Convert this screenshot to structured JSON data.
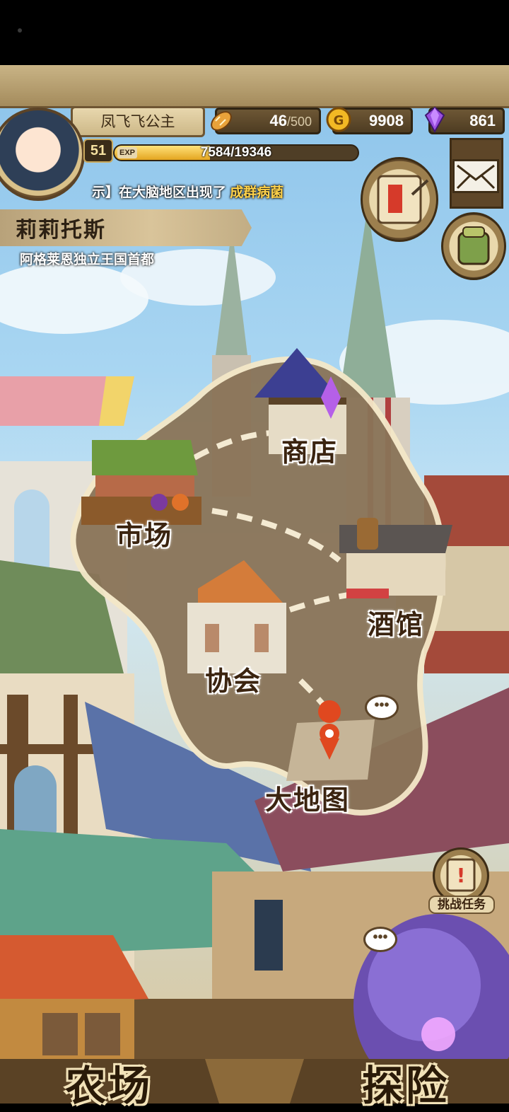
{
  "player": {
    "title": "凤飞飞公主",
    "level": "51",
    "exp_label": "EXP",
    "exp_text": "7584/19346",
    "exp_fraction": 0.392
  },
  "resources": {
    "bread": {
      "value": "46",
      "max": "/500",
      "icon": "bread-icon"
    },
    "gold": {
      "value": "9908",
      "icon": "gold-coin-icon"
    },
    "gem": {
      "value": "861",
      "icon": "purple-gem-icon"
    }
  },
  "notice": {
    "prefix": "示】在大脑地区出现了",
    "highlight": "成群病菌"
  },
  "location": {
    "name": "莉莉托斯",
    "subtitle": "阿格莱恩独立王国首都"
  },
  "map": {
    "shop": "商店",
    "market": "市场",
    "tavern": "酒馆",
    "guild": "协会",
    "world_map": "大地图"
  },
  "buttons": {
    "challenge": "挑战任务",
    "farm": "农场",
    "explore": "探险"
  },
  "colors": {
    "hud_wood": "#a48b5c",
    "highlight": "#ffd24a",
    "map_land": "#8a7458"
  }
}
